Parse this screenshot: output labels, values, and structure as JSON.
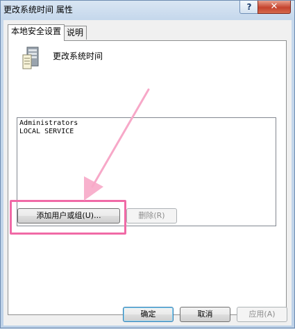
{
  "window": {
    "title": "更改系统时间 属性",
    "help_label": "?",
    "close_label": "✕"
  },
  "tabs": [
    {
      "label": "本地安全设置",
      "active": true
    },
    {
      "label": "说明",
      "active": false
    }
  ],
  "policy": {
    "icon": "server-policy-icon",
    "name": "更改系统时间"
  },
  "accounts": [
    "Administrators",
    "LOCAL SERVICE"
  ],
  "buttons": {
    "add_label": "添加用户或组(U)...",
    "remove_label": "删除(R)",
    "ok_label": "确定",
    "cancel_label": "取消",
    "apply_label": "应用(A)"
  },
  "annotation": {
    "highlight_color": "#f06aa6",
    "arrow_color": "#f7a8c8"
  }
}
